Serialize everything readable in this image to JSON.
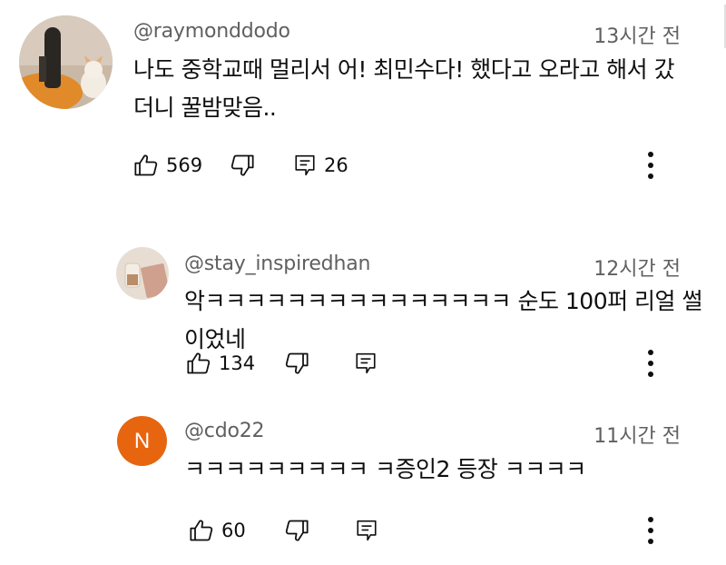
{
  "comments": [
    {
      "handle": "@raymonddodo",
      "time": "13시간 전",
      "text_lines": [
        "나도 중학교때 멀리서 어! 최민수다! 했다고 오라고 해서 갔",
        "더니 꿀밤맞음.."
      ],
      "likes": "569",
      "replies": "26",
      "avatar": {
        "type": "photo",
        "icon": "dog-photo-avatar"
      }
    },
    {
      "handle": "@stay_inspiredhan",
      "time": "12시간 전",
      "text_lines": [
        "악ㅋㅋㅋㅋㅋㅋㅋㅋㅋㅋㅋㅋㅋㅋㅋ 순도 100퍼 리얼 썰이었네"
      ],
      "likes": "134",
      "avatar": {
        "type": "photo",
        "icon": "coffee-photo-avatar"
      }
    },
    {
      "handle": "@cdo22",
      "time": "11시간 전",
      "text_lines": [
        "ㅋㅋㅋㅋㅋㅋㅋㅋㅋ ㅋ증인2 등장 ㅋㅋㅋㅋ"
      ],
      "likes": "60",
      "avatar": {
        "type": "letter",
        "letter": "N",
        "color": "#e8650f"
      }
    }
  ],
  "icons": {
    "like": "thumb-up-icon",
    "dislike": "thumb-down-icon",
    "reply": "reply-icon",
    "more": "more-vert-icon"
  }
}
